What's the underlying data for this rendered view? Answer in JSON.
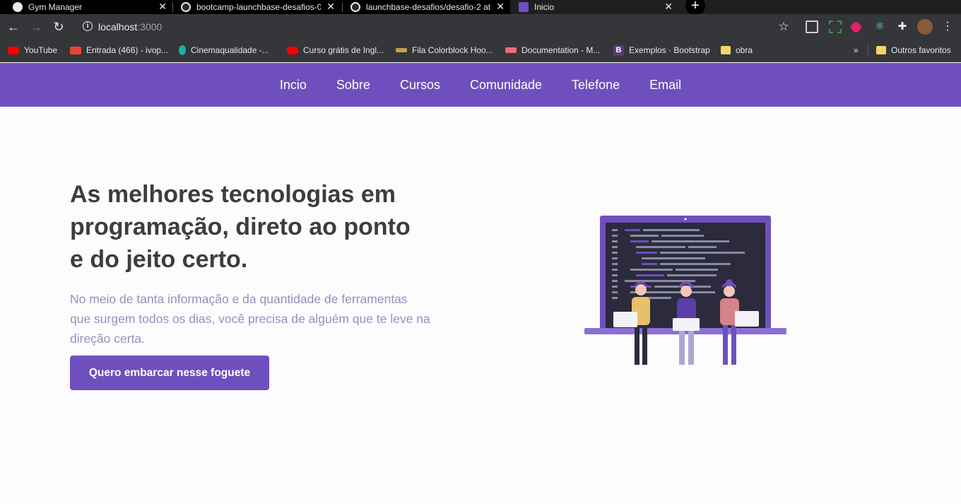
{
  "browser": {
    "tabs": [
      {
        "label": "Gym Manager",
        "active": false
      },
      {
        "label": "bootcamp-launchbase-desafios-0",
        "active": false
      },
      {
        "label": "launchbase-desafios/desafio-2 at",
        "active": false
      },
      {
        "label": "Inicio",
        "active": true
      }
    ],
    "new_tab_label": "+",
    "url_host": "localhost",
    "url_port": ":3000",
    "bookmarks": [
      {
        "label": "YouTube",
        "icon": "youtube-icon",
        "color": "#ff0000"
      },
      {
        "label": "Entrada (466) - ivop...",
        "icon": "gmail-icon",
        "color": "#ea4335"
      },
      {
        "label": "Cinemaqualidade -...",
        "icon": "cinema-icon",
        "color": "#19b39c"
      },
      {
        "label": "Curso grátis de Ingl...",
        "icon": "youtube-icon",
        "color": "#ff0000"
      },
      {
        "label": "Fila Colorblock Hoo...",
        "icon": "fila-icon",
        "color": "#c8a050"
      },
      {
        "label": "Documentation - M...",
        "icon": "materialize-icon",
        "color": "#ee6e73"
      },
      {
        "label": "Exemplos · Bootstrap",
        "icon": "bootstrap-icon",
        "color": "#563d7c"
      },
      {
        "label": "obra",
        "icon": "folder-icon",
        "color": "#f6d365"
      }
    ],
    "overflow_label": "»",
    "other_bookmarks": "Outros favoritos"
  },
  "nav": {
    "items": [
      "Incio",
      "Sobre",
      "Cursos",
      "Comunidade",
      "Telefone",
      "Email"
    ]
  },
  "hero": {
    "title_line1": "As melhores tecnologias em",
    "title_line2": "programação, direto ao ponto",
    "title_line3": "e do jeito certo.",
    "description": "No meio de tanta informação e da quantidade de ferramentas que surgem todos os dias, você precisa de alguém que te leve na direção certa.",
    "button_label": "Quero embarcar nesse foguete"
  },
  "colors": {
    "brand": "#6f4fbd",
    "text_dark": "#3d3d3f",
    "text_muted": "#9b8dbd"
  }
}
